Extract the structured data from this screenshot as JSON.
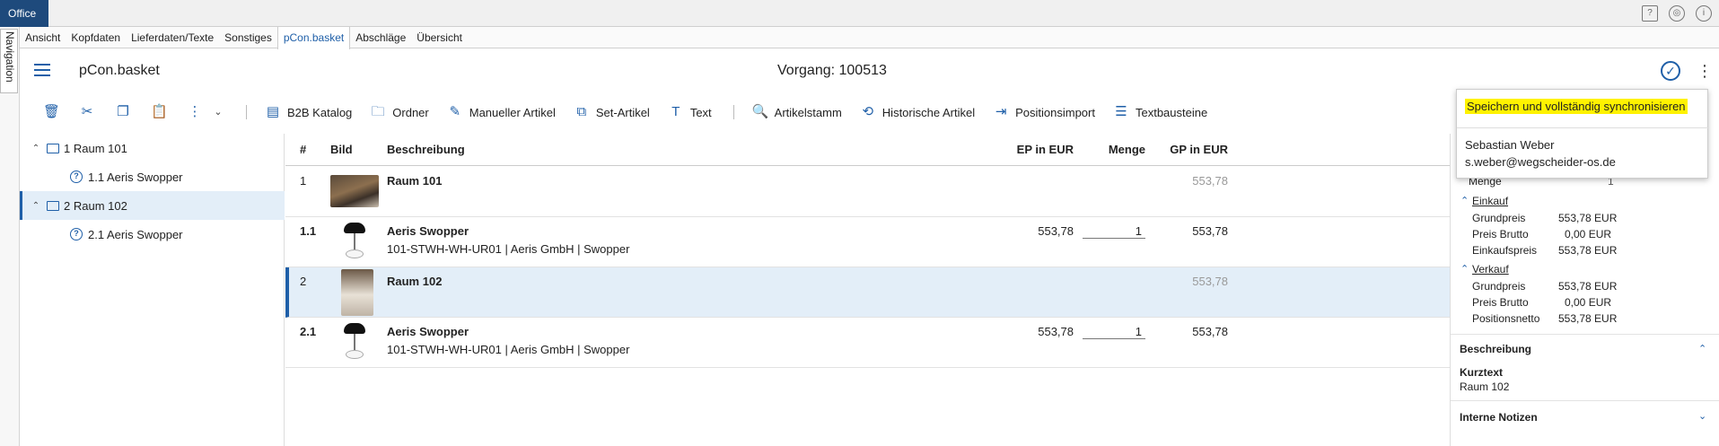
{
  "titlebar": {
    "office": "Office",
    "icons": [
      "help-icon",
      "globe-icon",
      "info-icon"
    ]
  },
  "navigation": {
    "label": "Navigation"
  },
  "menu": [
    "Ansicht",
    "Kopfdaten",
    "Lieferdaten/Texte",
    "Sonstiges",
    "pCon.basket",
    "Abschläge",
    "Übersicht"
  ],
  "header": {
    "title": "pCon.basket",
    "vorgang": "Vorgang: 100513"
  },
  "toolbar": {
    "b2b": "B2B Katalog",
    "ordner": "Ordner",
    "manuell": "Manueller Artikel",
    "set": "Set-Artikel",
    "text": "Text",
    "artikelstamm": "Artikelstamm",
    "historisch": "Historische Artikel",
    "positionsimport": "Positionsimport",
    "textbausteine": "Textbausteine"
  },
  "tree": [
    {
      "label": "1 Raum 101",
      "kind": "folder"
    },
    {
      "label": "1.1 Aeris Swopper",
      "kind": "article"
    },
    {
      "label": "2 Raum 102",
      "kind": "folder",
      "selected": true
    },
    {
      "label": "2.1 Aeris Swopper",
      "kind": "article"
    }
  ],
  "grid": {
    "headers": {
      "num": "#",
      "bild": "Bild",
      "beschreibung": "Beschreibung",
      "ep": "EP in EUR",
      "menge": "Menge",
      "gp": "GP in EUR"
    },
    "rows": [
      {
        "num": "1",
        "title": "Raum 101",
        "sub": "",
        "ep": "",
        "menge": "",
        "gp": "553,78"
      },
      {
        "num": "1.1",
        "title": "Aeris Swopper",
        "sub": "101-STWH-WH-UR01 | Aeris GmbH | Swopper",
        "ep": "553,78",
        "menge": "1",
        "gp": "553,78"
      },
      {
        "num": "2",
        "title": "Raum 102",
        "sub": "",
        "ep": "",
        "menge": "",
        "gp": "553,78"
      },
      {
        "num": "2.1",
        "title": "Aeris Swopper",
        "sub": "101-STWH-WH-UR01 | Aeris GmbH | Swopper",
        "ep": "553,78",
        "menge": "1",
        "gp": "553,78"
      }
    ]
  },
  "popup": {
    "sync": "Speichern und vollständig synchronisieren",
    "user_name": "Sebastian Weber",
    "user_email": "s.weber@wegscheider-os.de"
  },
  "rpanel": {
    "menge_label": "Menge",
    "menge_value": "1",
    "einkauf": "Einkauf",
    "einkauf_rows": [
      {
        "label": "Grundpreis",
        "value": "553,78 EUR"
      },
      {
        "label": "Preis Brutto",
        "value": "0,00 EUR"
      },
      {
        "label": "Einkaufspreis",
        "value": "553,78 EUR"
      }
    ],
    "verkauf": "Verkauf",
    "verkauf_rows": [
      {
        "label": "Grundpreis",
        "value": "553,78 EUR"
      },
      {
        "label": "Preis Brutto",
        "value": "0,00 EUR"
      },
      {
        "label": "Positionsnetto",
        "value": "553,78 EUR"
      }
    ],
    "beschreibung": "Beschreibung",
    "kurztext_label": "Kurztext",
    "kurztext_value": "Raum 102",
    "notizen": "Interne Notizen"
  },
  "colors": {
    "accent": "#1f5fa8",
    "office": "#1e4a7c",
    "selection": "#e3eef8",
    "highlight": "#fff200"
  }
}
